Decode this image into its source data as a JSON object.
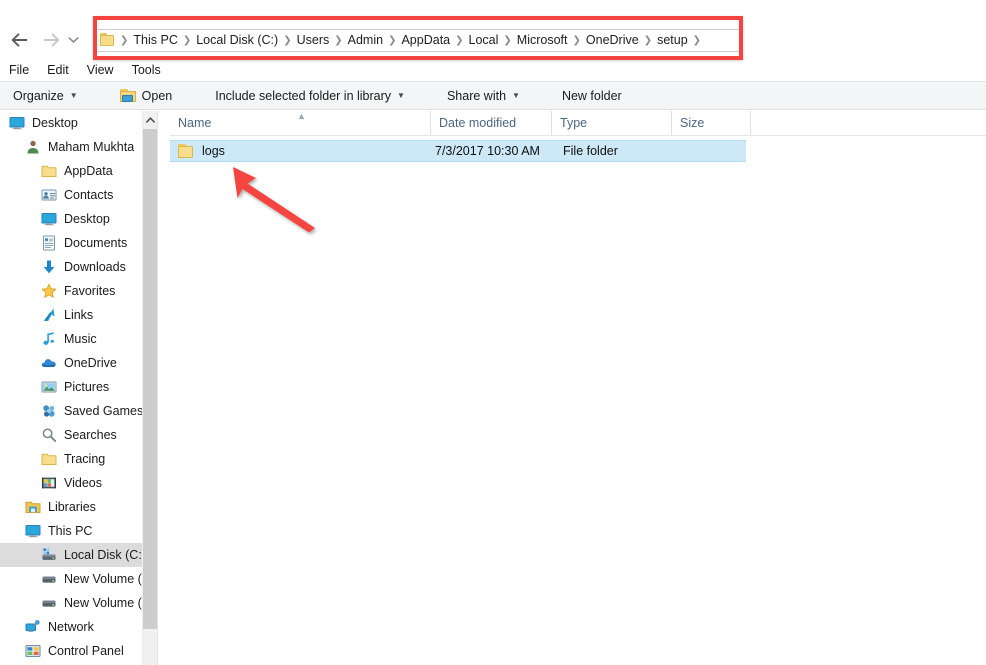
{
  "window": {
    "title": "setup"
  },
  "nav": {
    "back_label": "Back",
    "forward_label": "Forward",
    "recent_label": "Recent locations",
    "address_icon": "folder-icon",
    "breadcrumbs": [
      "This PC",
      "Local Disk (C:)",
      "Users",
      "Admin",
      "AppData",
      "Local",
      "Microsoft",
      "OneDrive",
      "setup"
    ]
  },
  "menubar": {
    "items": [
      "File",
      "Edit",
      "View",
      "Tools"
    ]
  },
  "commandbar": {
    "organize": "Organize",
    "open": "Open",
    "include": "Include selected folder in library",
    "share": "Share with",
    "newfolder": "New folder",
    "caret": "▼"
  },
  "sidebar": {
    "items": [
      {
        "label": "Desktop",
        "icon": "monitor-icon",
        "indent": 0,
        "selected": false
      },
      {
        "label": "Maham Mukhta",
        "icon": "user-icon",
        "indent": 1,
        "selected": false
      },
      {
        "label": "AppData",
        "icon": "folder-icon",
        "indent": 2,
        "selected": false
      },
      {
        "label": "Contacts",
        "icon": "contacts-icon",
        "indent": 2,
        "selected": false
      },
      {
        "label": "Desktop",
        "icon": "monitor-icon",
        "indent": 2,
        "selected": false
      },
      {
        "label": "Documents",
        "icon": "documents-icon",
        "indent": 2,
        "selected": false
      },
      {
        "label": "Downloads",
        "icon": "download-icon",
        "indent": 2,
        "selected": false
      },
      {
        "label": "Favorites",
        "icon": "star-icon",
        "indent": 2,
        "selected": false
      },
      {
        "label": "Links",
        "icon": "link-icon",
        "indent": 2,
        "selected": false
      },
      {
        "label": "Music",
        "icon": "music-note-icon",
        "indent": 2,
        "selected": false
      },
      {
        "label": "OneDrive",
        "icon": "cloud-icon",
        "indent": 2,
        "selected": false
      },
      {
        "label": "Pictures",
        "icon": "pictures-icon",
        "indent": 2,
        "selected": false
      },
      {
        "label": "Saved Games",
        "icon": "saved-games-icon",
        "indent": 2,
        "selected": false
      },
      {
        "label": "Searches",
        "icon": "magnifier-icon",
        "indent": 2,
        "selected": false
      },
      {
        "label": "Tracing",
        "icon": "folder-icon",
        "indent": 2,
        "selected": false
      },
      {
        "label": "Videos",
        "icon": "film-icon",
        "indent": 2,
        "selected": false
      },
      {
        "label": "Libraries",
        "icon": "libraries-icon",
        "indent": 1,
        "selected": false
      },
      {
        "label": "This PC",
        "icon": "monitor-icon",
        "indent": 1,
        "selected": false
      },
      {
        "label": "Local Disk (C:)",
        "icon": "hard-drive-c-icon",
        "indent": 2,
        "selected": true
      },
      {
        "label": "New Volume (D:)",
        "icon": "hard-drive-icon",
        "indent": 2,
        "selected": false
      },
      {
        "label": "New Volume (E:)",
        "icon": "hard-drive-icon",
        "indent": 2,
        "selected": false
      },
      {
        "label": "Network",
        "icon": "network-icon",
        "indent": 1,
        "selected": false
      },
      {
        "label": "Control Panel",
        "icon": "control-panel-icon",
        "indent": 1,
        "selected": false
      }
    ]
  },
  "filelist": {
    "columns": [
      {
        "label": "Name",
        "sorted": true
      },
      {
        "label": "Date modified",
        "sorted": false
      },
      {
        "label": "Type",
        "sorted": false
      },
      {
        "label": "Size",
        "sorted": false
      }
    ],
    "sort_indicator": "▲",
    "rows": [
      {
        "name": "logs",
        "date_modified": "7/3/2017 10:30 AM",
        "type": "File folder",
        "size": "",
        "icon": "folder-icon",
        "selected": true
      }
    ]
  },
  "annotations": {
    "rect_color": "#f4443f",
    "arrow_color": "#f4443f",
    "rect_target": "address-bar-breadcrumbs",
    "arrow_target": "logs-folder-row"
  }
}
